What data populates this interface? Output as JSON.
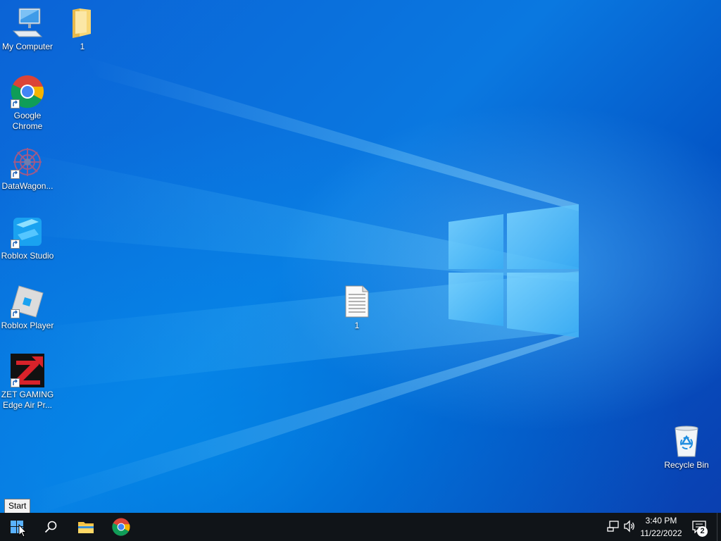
{
  "desktop": {
    "icons": [
      {
        "label": "My Computer"
      },
      {
        "label": "1"
      },
      {
        "label": "Google Chrome"
      },
      {
        "label": "DataWagon..."
      },
      {
        "label": "Roblox Studio"
      },
      {
        "label": "Roblox Player"
      },
      {
        "label": "ZET GAMING Edge Air Pr..."
      },
      {
        "label": "1"
      },
      {
        "label": "Recycle Bin"
      }
    ]
  },
  "tooltip": {
    "text": "Start"
  },
  "taskbar": {
    "clock": {
      "time": "3:40 PM",
      "date": "11/22/2022"
    },
    "notifications": {
      "count": "2"
    },
    "pinned": [
      "start-button",
      "search-icon",
      "file-explorer-icon",
      "chrome-icon"
    ]
  },
  "colors": {
    "accent": "#0078d7",
    "taskbar": "#101418",
    "wallpaper_blue": "#0a6fe0"
  }
}
